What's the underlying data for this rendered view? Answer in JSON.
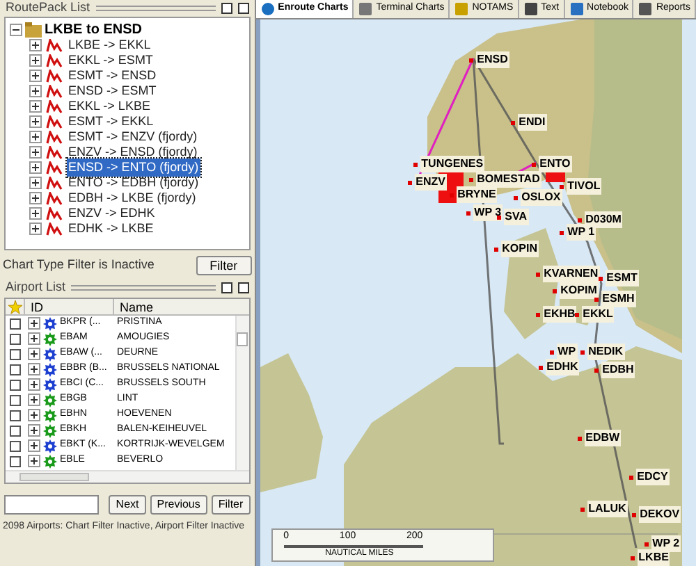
{
  "routepack": {
    "title": "RoutePack List",
    "root": {
      "label": "LKBE to ENSD",
      "expanded": true,
      "children": [
        {
          "label": "LKBE -> EKKL",
          "selected": false
        },
        {
          "label": "EKKL -> ESMT",
          "selected": false
        },
        {
          "label": "ESMT -> ENSD",
          "selected": false
        },
        {
          "label": "ENSD -> ESMT",
          "selected": false
        },
        {
          "label": "EKKL -> LKBE",
          "selected": false
        },
        {
          "label": "ESMT -> EKKL",
          "selected": false
        },
        {
          "label": "ESMT -> ENZV (fjordy)",
          "selected": false
        },
        {
          "label": "ENZV -> ENSD (fjordy)",
          "selected": false
        },
        {
          "label": "ENSD -> ENTO (fjordy)",
          "selected": true
        },
        {
          "label": "ENTO -> EDBH (fjordy)",
          "selected": false
        },
        {
          "label": "EDBH -> LKBE (fjordy)",
          "selected": false
        },
        {
          "label": "ENZV -> EDHK",
          "selected": false
        },
        {
          "label": "EDHK -> LKBE",
          "selected": false
        }
      ]
    },
    "filter_status": "Chart Type Filter is Inactive",
    "filter_button": "Filter"
  },
  "airports": {
    "title": "Airport List",
    "columns": [
      "ID",
      "Name"
    ],
    "rows": [
      {
        "id": "BKPR (...",
        "name": "PRISTINA",
        "checked": false,
        "color": "#1e40d0"
      },
      {
        "id": "EBAM",
        "name": "AMOUGIES",
        "checked": false,
        "color": "#1a9a1a"
      },
      {
        "id": "EBAW (...",
        "name": "DEURNE",
        "checked": false,
        "color": "#1e40d0"
      },
      {
        "id": "EBBR (B...",
        "name": "BRUSSELS NATIONAL",
        "checked": false,
        "color": "#1e40d0"
      },
      {
        "id": "EBCI (C...",
        "name": "BRUSSELS SOUTH",
        "checked": false,
        "color": "#1e40d0"
      },
      {
        "id": "EBGB",
        "name": "LINT",
        "checked": false,
        "color": "#1a9a1a"
      },
      {
        "id": "EBHN",
        "name": "HOEVENEN",
        "checked": false,
        "color": "#1a9a1a"
      },
      {
        "id": "EBKH",
        "name": "BALEN-KEIHEUVEL",
        "checked": false,
        "color": "#1a9a1a"
      },
      {
        "id": "EBKT (K...",
        "name": "KORTRIJK-WEVELGEM",
        "checked": false,
        "color": "#1e40d0"
      },
      {
        "id": "EBLE",
        "name": "BEVERLO",
        "checked": false,
        "color": "#1a9a1a"
      }
    ],
    "buttons": [
      "Next",
      "Previous",
      "Filter"
    ],
    "status": "2098 Airports: Chart Filter Inactive, Airport Filter Inactive"
  },
  "tabs": [
    {
      "label": "Enroute Charts",
      "selected": true
    },
    {
      "label": "Terminal Charts",
      "selected": false
    },
    {
      "label": "NOTAMS",
      "selected": false
    },
    {
      "label": "Text",
      "selected": false
    },
    {
      "label": "Notebook",
      "selected": false
    },
    {
      "label": "Reports",
      "selected": false
    }
  ],
  "map": {
    "waypoints": [
      "ENSD",
      "ENDI",
      "TUNGENES",
      "ENTO",
      "ENZV",
      "BOMESTAD",
      "TIVOL",
      "BRYNE",
      "OSLOX",
      "WP 3",
      "SVA",
      "D030M",
      "WP 1",
      "KOPIN",
      "KVARNEN",
      "ESMT",
      "KOPIM",
      "ESMH",
      "EKHB",
      "EKKL",
      "WP",
      "NEDIK",
      "EDHK",
      "EDBH",
      "EDBW",
      "EDCY",
      "LALUK",
      "DEKOV",
      "WP 2",
      "LKBE"
    ],
    "scale": {
      "ticks": [
        "0",
        "100",
        "200"
      ],
      "unit": "NAUTICAL MILES"
    }
  }
}
